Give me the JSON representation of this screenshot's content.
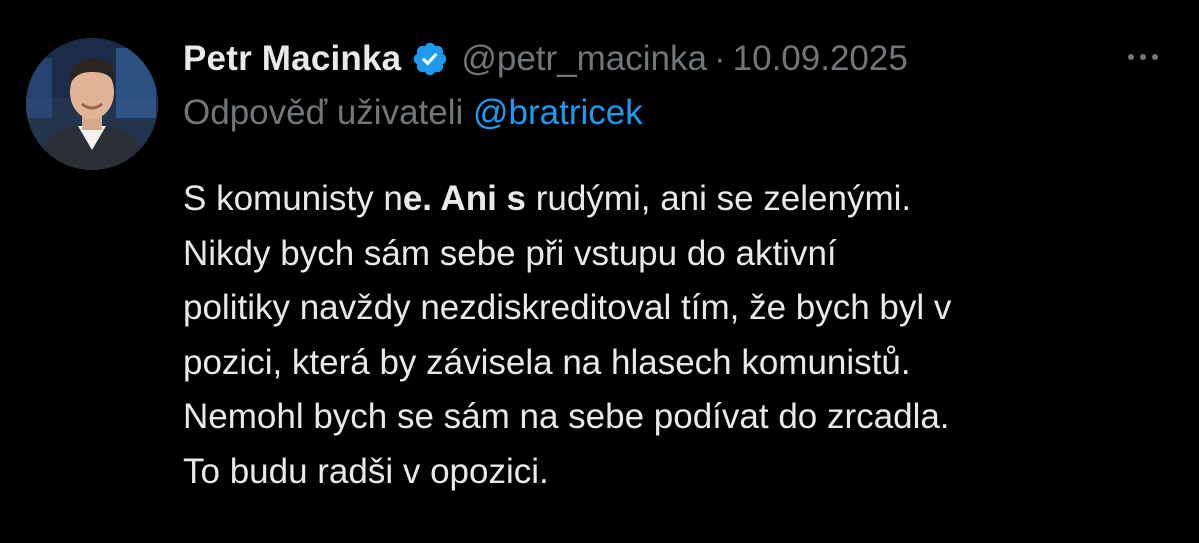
{
  "tweet": {
    "author_name": "Petr Macinka",
    "handle": "@petr_macinka",
    "separator": "·",
    "date": "10.09.2025",
    "reply_prefix": "Odpověď uživateli ",
    "reply_mention": "@bratricek",
    "verified_icon": "verified-badge-icon",
    "more_icon": "more-horizontal-icon",
    "body_lines": {
      "l1_a": "S komunisty n",
      "l1_b": "e. Ani s",
      "l1_c": " rudými, ani se zelenými.",
      "l2": "Nikdy bych sám sebe při vstupu do aktivní",
      "l3": "politiky navždy nezdiskreditoval tím, že bych byl v",
      "l4": "pozici, která by závisela na hlasech komunistů.",
      "l5": "Nemohl bych se sám na sebe podívat do zrcadla.",
      "l6": "To budu radši v opozici."
    }
  },
  "colors": {
    "background": "#000000",
    "primary_text": "#e7e9ea",
    "secondary_text": "#71767b",
    "accent": "#1d9bf0"
  }
}
